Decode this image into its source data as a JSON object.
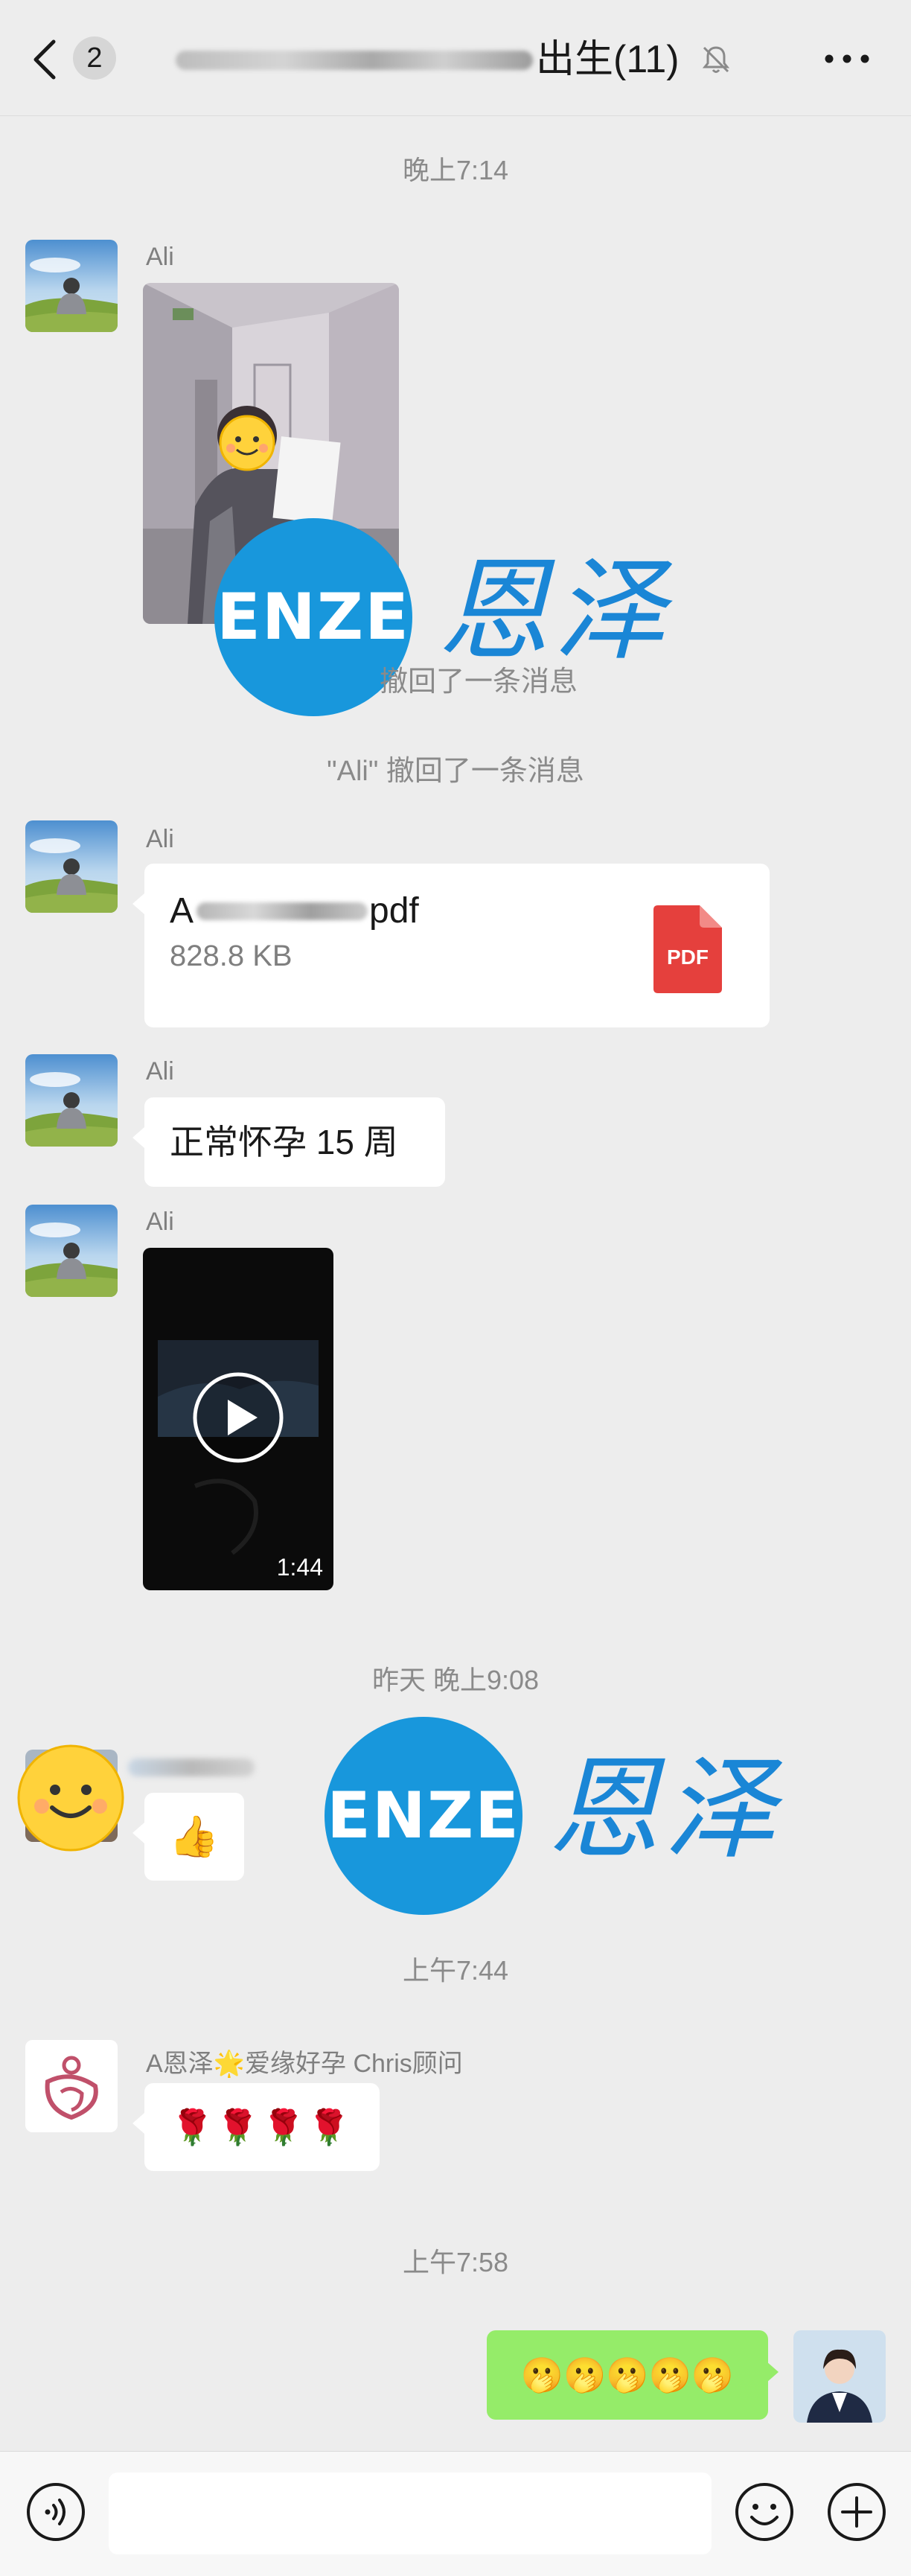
{
  "header": {
    "unread_count": "2",
    "group_title": "出生(11)"
  },
  "messages": {
    "ts1": "晚上7:14",
    "ali_name": "Ali",
    "recall_1": "撤回了一条消息",
    "recall_2": "\"Ali\" 撤回了一条消息",
    "file_name": "pdf",
    "file_size": "828.8 KB",
    "file_type": "PDF",
    "text_msg": "正常怀孕 15 周",
    "video_duration": "1:44",
    "ts2": "昨天 晚上9:08",
    "thumbs_emoji": "👍",
    "ts3": "上午7:44",
    "advisor_name": "A恩泽🌟爱缘好孕 Chris顾问",
    "roses": "🌹🌹🌹🌹",
    "ts4": "上午7:58",
    "my_reply": "🫢🫢🫢🫢🫢"
  },
  "watermark": {
    "brand_en": "ENZE",
    "brand_cn": "恩泽"
  },
  "composer": {
    "input_placeholder": ""
  },
  "colors": {
    "background": "#ededed",
    "own_bubble": "#95ec69",
    "watermark_blue": "#1897dc",
    "pdf_red": "#e5403d"
  }
}
